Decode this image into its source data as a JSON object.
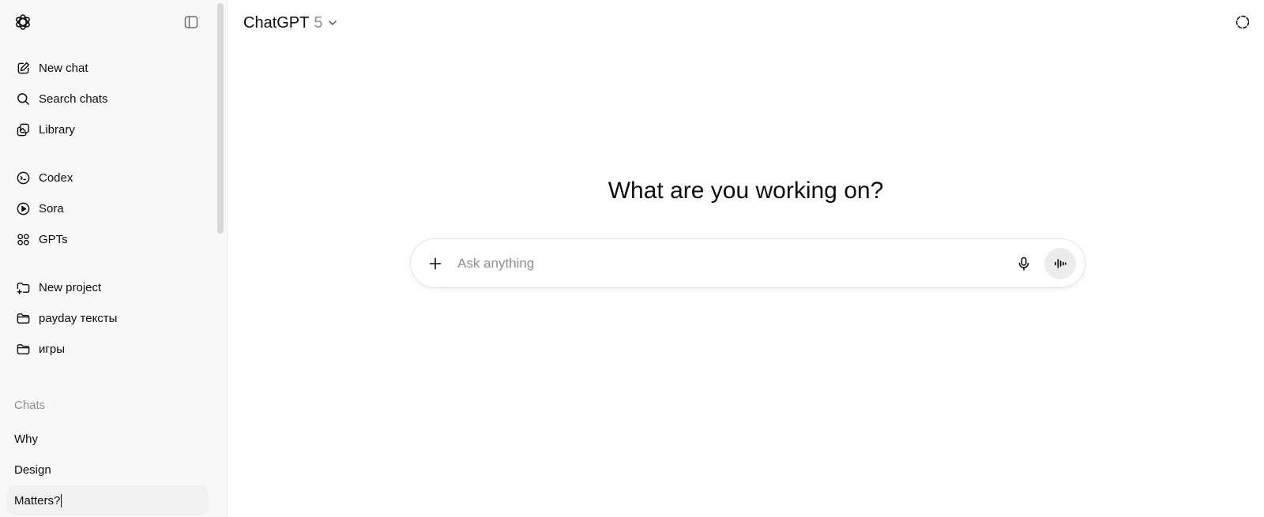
{
  "sidebar": {
    "logo_icon": "openai-logo-icon",
    "toggle_icon": "sidebar-toggle-icon",
    "primary": [
      {
        "label": "New chat",
        "icon": "edit-icon"
      },
      {
        "label": "Search chats",
        "icon": "search-icon"
      },
      {
        "label": "Library",
        "icon": "images-icon"
      }
    ],
    "apps": [
      {
        "label": "Codex",
        "icon": "terminal-icon"
      },
      {
        "label": "Sora",
        "icon": "play-icon"
      },
      {
        "label": "GPTs",
        "icon": "grid-icon"
      }
    ],
    "projects": [
      {
        "label": "New project",
        "icon": "folder-plus-icon"
      },
      {
        "label": "payday тексты",
        "icon": "folder-icon"
      },
      {
        "label": "игры",
        "icon": "folder-icon"
      }
    ],
    "chats_label": "Chats",
    "chats": [
      {
        "label": "Why"
      },
      {
        "label": "Design"
      },
      {
        "label": "Matters?"
      }
    ]
  },
  "header": {
    "model_name": "ChatGPT",
    "model_version": "5",
    "temporary_chat_icon": "dashed-circle-icon"
  },
  "main": {
    "headline": "What are you working on?",
    "composer": {
      "placeholder": "Ask anything",
      "value": ""
    }
  },
  "colors": {
    "sidebar_bg": "#f9f9f9",
    "text": "#0d0d0d",
    "muted": "#8f8f8f",
    "active_bg": "#f1f1f1",
    "voice_btn_bg": "#ececec"
  }
}
